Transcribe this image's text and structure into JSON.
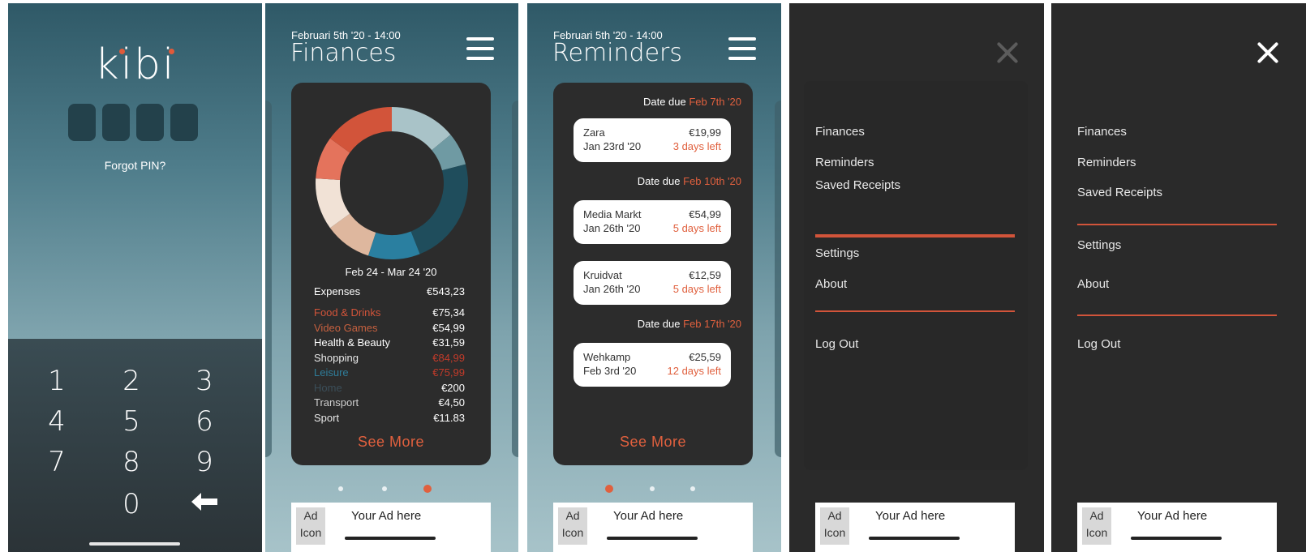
{
  "lock": {
    "logo": "kibi",
    "forgot_pin": "Forgot PIN?",
    "keys": [
      "1",
      "2",
      "3",
      "4",
      "5",
      "6",
      "7",
      "8",
      "9",
      "0"
    ]
  },
  "finances": {
    "date": "Februari 5th '20 - 14:00",
    "title": "Finances",
    "period": "Feb 24 - Mar 24 '20",
    "expenses_label": "Expenses",
    "expenses_total": "€543,23",
    "categories": [
      {
        "label": "Food & Drinks",
        "amount": "€75,34",
        "label_color": "#d2543a",
        "amount_color": "#ffffff"
      },
      {
        "label": "Video Games",
        "amount": "€54,99",
        "label_color": "#c5603f",
        "amount_color": "#ffffff"
      },
      {
        "label": "Health & Beauty",
        "amount": "€31,59",
        "label_color": "#ffffff",
        "amount_color": "#ffffff"
      },
      {
        "label": "Shopping",
        "amount": "€84,99",
        "label_color": "#e8e8e8",
        "amount_color": "#c23b2a"
      },
      {
        "label": "Leisure",
        "amount": "€75,99",
        "label_color": "#2f7d9a",
        "amount_color": "#c23b2a"
      },
      {
        "label": "Home",
        "amount": "€200",
        "label_color": "#3b4e59",
        "amount_color": "#ffffff"
      },
      {
        "label": "Transport",
        "amount": "€4,50",
        "label_color": "#cfcfcf",
        "amount_color": "#ffffff"
      },
      {
        "label": "Sport",
        "amount": "€11.83",
        "label_color": "#e8e8e8",
        "amount_color": "#ffffff"
      }
    ],
    "see_more": "See More",
    "donut_segments": [
      {
        "color": "#a9c3c8",
        "value": 14
      },
      {
        "color": "#6f9aa3",
        "value": 7
      },
      {
        "color": "#1f4d5c",
        "value": 23
      },
      {
        "color": "#2a7fa0",
        "value": 11
      },
      {
        "color": "#deb79e",
        "value": 10
      },
      {
        "color": "#f1e2d6",
        "value": 11
      },
      {
        "color": "#e4735c",
        "value": 9
      },
      {
        "color": "#d2543a",
        "value": 15
      }
    ]
  },
  "reminders": {
    "date": "Februari 5th '20 - 14:00",
    "title": "Reminders",
    "groups": [
      {
        "due_label": "Date due",
        "due_date": "Feb 7th '20",
        "items": [
          {
            "name": "Zara",
            "date": "Jan 23rd '20",
            "amount": "€19,99",
            "left": "3 days left"
          }
        ]
      },
      {
        "due_label": "Date due",
        "due_date": "Feb 10th '20",
        "items": [
          {
            "name": "Media Markt",
            "date": "Jan 26th '20",
            "amount": "€54,99",
            "left": "5 days left"
          },
          {
            "name": "Kruidvat",
            "date": "Jan 26th '20",
            "amount": "€12,59",
            "left": "5 days left"
          }
        ]
      },
      {
        "due_label": "Date due",
        "due_date": "Feb 17th '20",
        "items": [
          {
            "name": "Wehkamp",
            "date": "Feb 3rd '20",
            "amount": "€25,59",
            "left": "12 days left"
          }
        ]
      }
    ],
    "see_more": "See More"
  },
  "menu": {
    "items": [
      "Finances",
      "Reminders",
      "Saved Receipts"
    ],
    "settings": "Settings",
    "about": "About",
    "logout": "Log Out"
  },
  "ad": {
    "icon": "Ad Icon",
    "icon_line1": "Ad",
    "icon_line2": "Icon",
    "text": "Your Ad here"
  },
  "colors": {
    "accent": "#e0603e",
    "card": "#2c2c2c",
    "menu_bg": "#2a2a2a"
  }
}
